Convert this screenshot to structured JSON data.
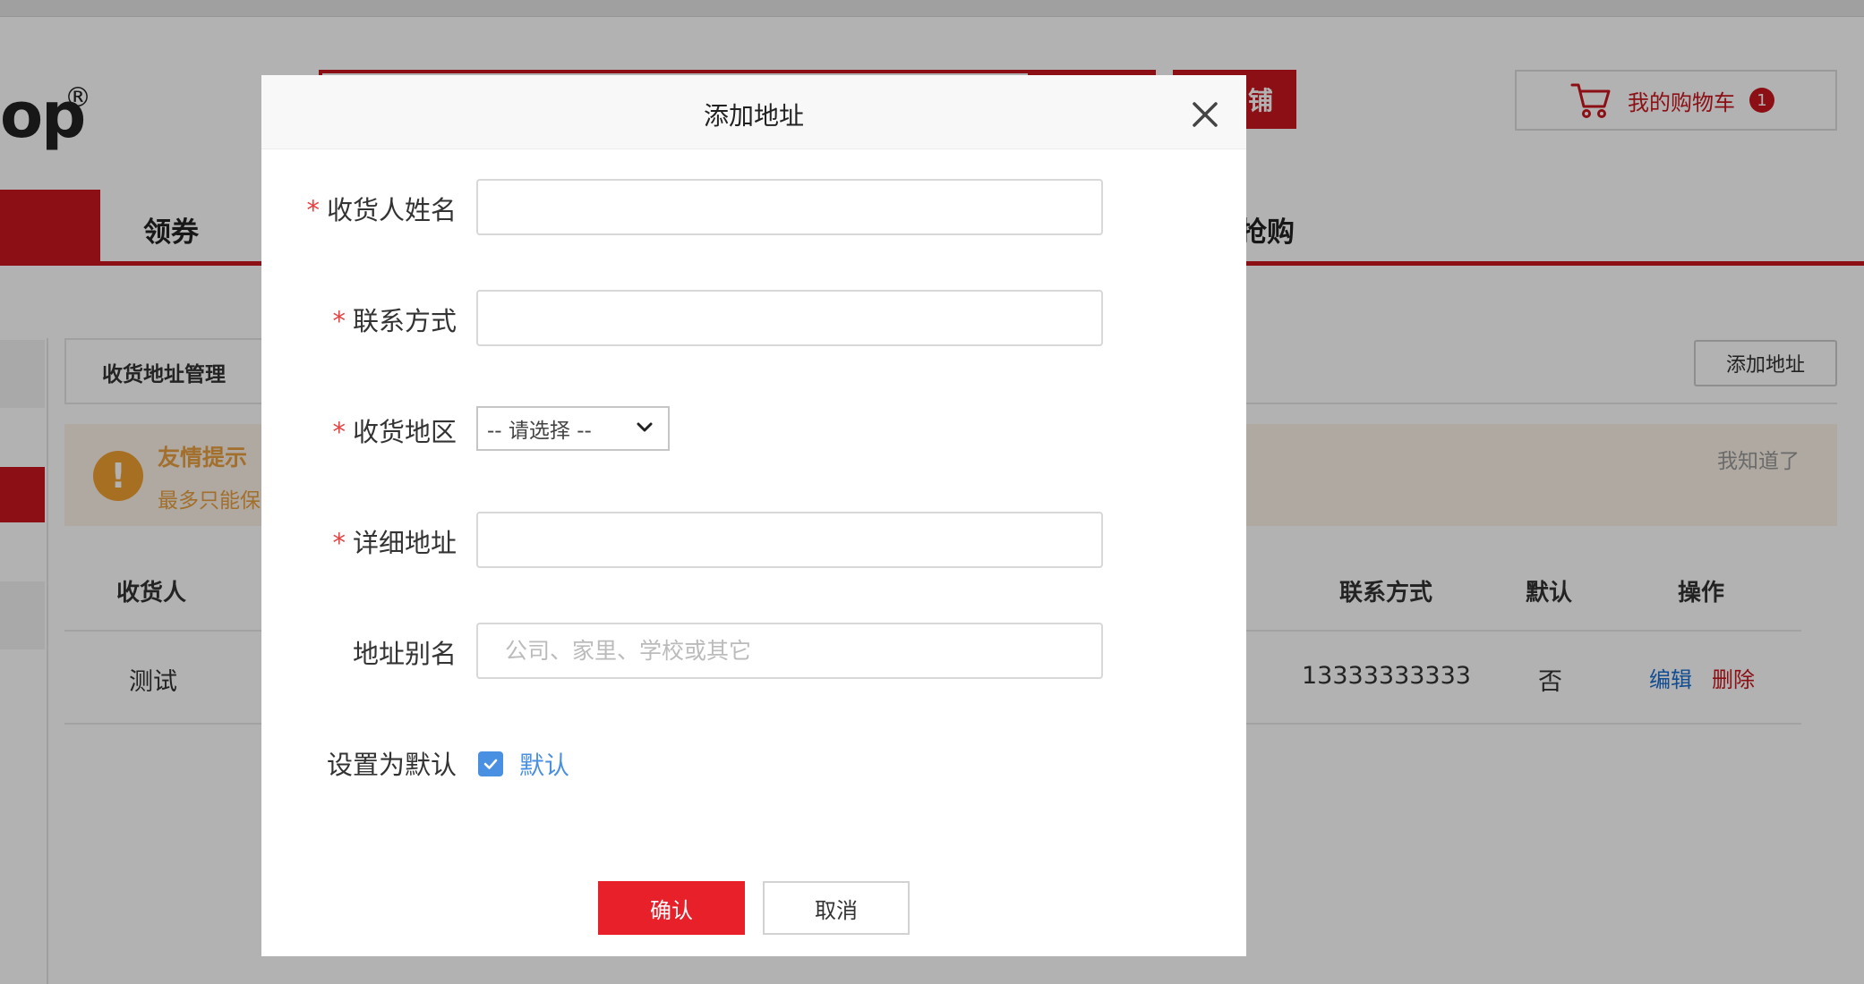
{
  "header": {
    "logo_text": "op",
    "logo_reg": "®",
    "shop_button": "铺",
    "cart_label": "我的购物车",
    "cart_count": "1"
  },
  "nav": {
    "item_coupon": "领券",
    "item_flash": "抢购"
  },
  "address_page": {
    "tab_label": "收货地址管理",
    "add_button": "添加地址",
    "tip_title": "友情提示",
    "tip_text": "最多只能保",
    "tip_dismiss": "我知道了",
    "columns": {
      "receiver": "收货人",
      "phone": "联系方式",
      "default": "默认",
      "action": "操作"
    },
    "row": {
      "receiver": "测试",
      "phone": "13333333333",
      "default": "否",
      "edit": "编辑",
      "delete": "删除"
    }
  },
  "modal": {
    "title": "添加地址",
    "required_mark": "*",
    "fields": {
      "name_label": "收货人姓名",
      "phone_label": "联系方式",
      "region_label": "收货地区",
      "region_value": "-- 请选择 --",
      "detail_label": "详细地址",
      "alias_label": "地址别名",
      "alias_placeholder": "公司、家里、学校或其它",
      "default_label": "设置为默认",
      "default_checkbox_label": "默认"
    },
    "confirm": "确认",
    "cancel": "取消"
  },
  "colors": {
    "brand_red": "#c8161d",
    "link_blue": "#4a90e2",
    "tip_orange": "#f0a030"
  }
}
